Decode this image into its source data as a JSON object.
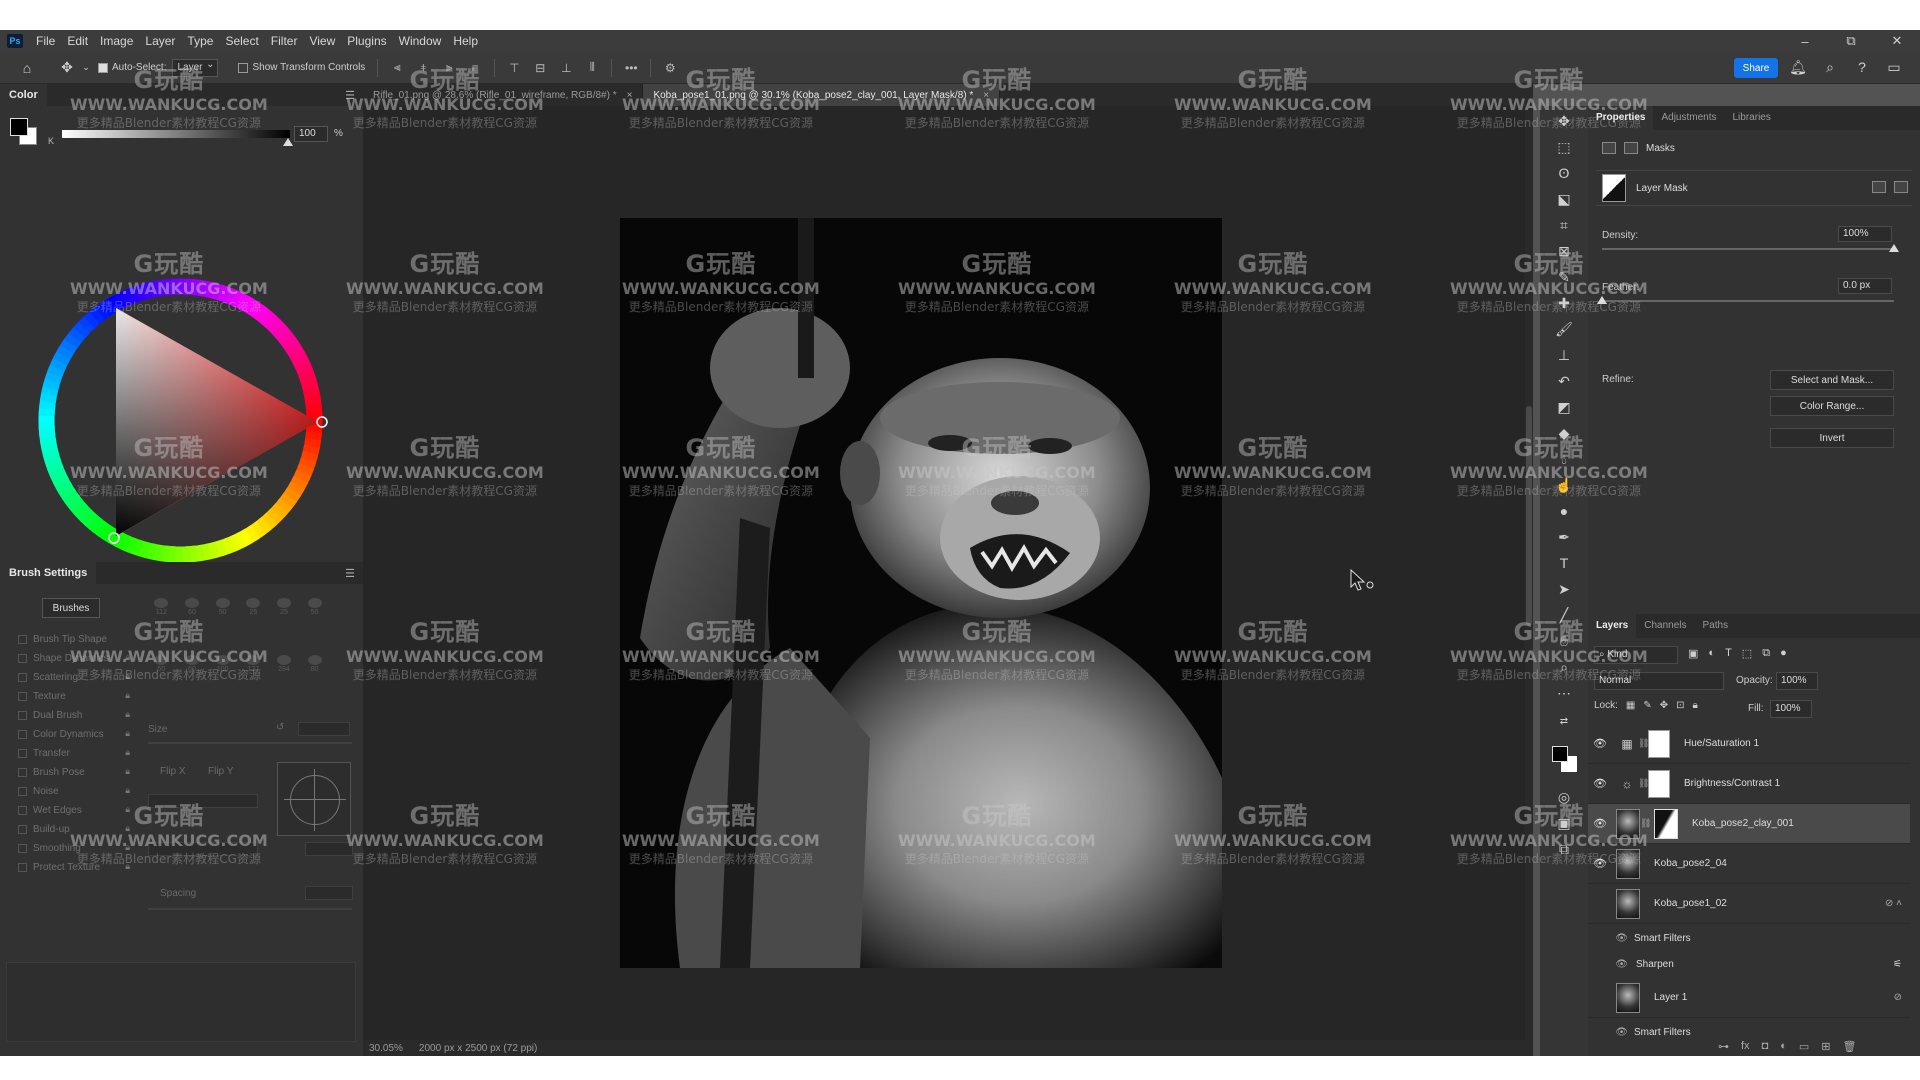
{
  "menubar": {
    "app_icon": "Ps",
    "items": [
      "File",
      "Edit",
      "Image",
      "Layer",
      "Type",
      "Select",
      "Filter",
      "View",
      "Plugins",
      "Window",
      "Help"
    ],
    "window_controls": {
      "minimize": "–",
      "restore": "⧉",
      "close": "✕"
    }
  },
  "options_bar": {
    "auto_select_label": "Auto-Select:",
    "auto_select_target": "Layer",
    "show_transform_label": "Show Transform Controls",
    "more": "•••",
    "share_label": "Share"
  },
  "color_panel": {
    "tab": "Color",
    "channel_label": "K",
    "value": "100",
    "unit": "%",
    "foreground": "#000000",
    "background": "#ffffff",
    "hue_selected": "red"
  },
  "brush_panel": {
    "tab": "Brush Settings",
    "brushes_button": "Brushes",
    "options": [
      {
        "label": "Brush Tip Shape",
        "locked": false
      },
      {
        "label": "Shape Dynamics",
        "locked": true
      },
      {
        "label": "Scattering",
        "locked": true
      },
      {
        "label": "Texture",
        "locked": true
      },
      {
        "label": "Dual Brush",
        "locked": true
      },
      {
        "label": "Color Dynamics",
        "locked": true
      },
      {
        "label": "Transfer",
        "locked": true
      },
      {
        "label": "Brush Pose",
        "locked": true
      },
      {
        "label": "Noise",
        "locked": true
      },
      {
        "label": "Wet Edges",
        "locked": true
      },
      {
        "label": "Build-up",
        "locked": true
      },
      {
        "label": "Smoothing",
        "locked": true
      },
      {
        "label": "Protect Texture",
        "locked": true
      }
    ],
    "tip_sizes": [
      "112",
      "60",
      "50",
      "25",
      "25",
      "50",
      "50",
      "60",
      "100",
      "127",
      "284",
      "80"
    ],
    "size_label": "Size",
    "flip_x": "Flip X",
    "flip_y": "Flip Y",
    "spacing_label": "Spacing"
  },
  "document_tabs": [
    {
      "label": "Rifle_01.png @ 28.6% (Rifle_01_wireframe, RGB/8#) *",
      "active": false
    },
    {
      "label": "Koba_pose1_01.png @ 30.1% (Koba_pose2_clay_001, Layer Mask/8) *",
      "active": true
    }
  ],
  "status_bar": {
    "zoom": "30.05%",
    "doc_size": "2000 px x 2500 px (72 ppi)"
  },
  "properties_panel": {
    "tabs": [
      "Properties",
      "Adjustments",
      "Libraries"
    ],
    "masks_label": "Masks",
    "layer_mask_label": "Layer Mask",
    "density_label": "Density:",
    "density_value": "100%",
    "density_fraction": 1.0,
    "feather_label": "Feather:",
    "feather_value": "0.0 px",
    "refine_label": "Refine:",
    "select_mask_button": "Select and Mask...",
    "color_range_button": "Color Range...",
    "invert_button": "Invert"
  },
  "layers_panel": {
    "tabs": [
      "Layers",
      "Channels",
      "Paths"
    ],
    "filter_kind": "Kind",
    "blend_mode": "Normal",
    "opacity_label": "Opacity:",
    "opacity_value": "100%",
    "lock_label": "Lock:",
    "fill_label": "Fill:",
    "fill_value": "100%",
    "layers": [
      {
        "name": "Hue/Saturation 1",
        "type": "adjustment",
        "icon": "hue-sat-icon",
        "visible": true
      },
      {
        "name": "Brightness/Contrast 1",
        "type": "adjustment",
        "icon": "brightness-icon",
        "visible": true
      },
      {
        "name": "Koba_pose2_clay_001",
        "type": "masked",
        "visible": true,
        "selected": true
      },
      {
        "name": "Koba_pose2_04",
        "type": "image",
        "visible": true
      },
      {
        "name": "Koba_pose1_02",
        "type": "smart",
        "visible": false
      },
      {
        "name": "Smart Filters",
        "type": "smart-filters"
      },
      {
        "name": "Sharpen",
        "type": "filter"
      },
      {
        "name": "Layer 1",
        "type": "smart",
        "visible": false
      },
      {
        "name": "Smart Filters",
        "type": "smart-filters"
      }
    ]
  },
  "watermark": {
    "logo": "G玩酷",
    "url": "WWW.WANKUCG.COM",
    "sub": "更多精品Blender素材教程CG资源"
  }
}
